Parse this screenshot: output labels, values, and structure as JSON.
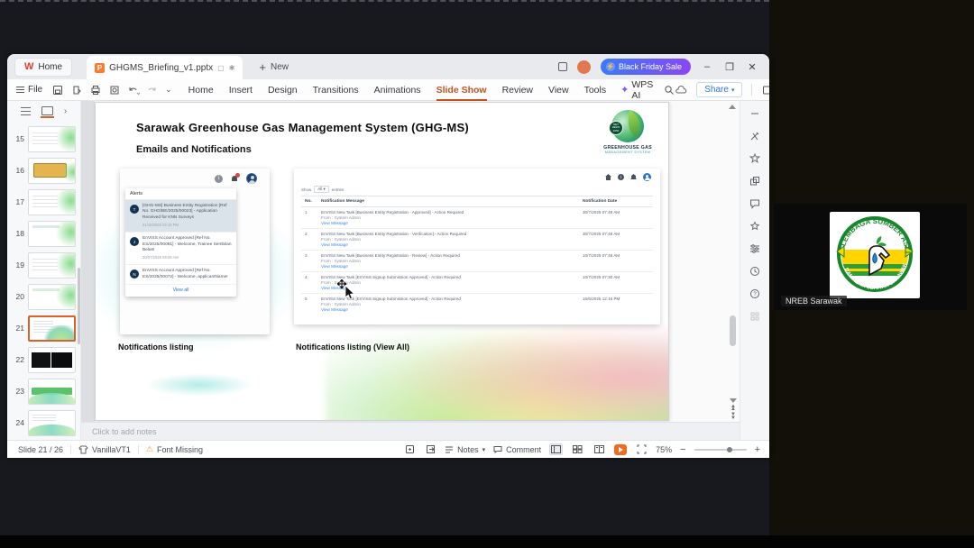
{
  "meeting": {
    "participant_label": "NREB Sarawak"
  },
  "titlebar": {
    "home_tab": "Home",
    "doc_tab": "GHGMS_Briefing_v1.pptx",
    "new_tab": "New",
    "promo": "Black Friday Sale",
    "minimize": "–",
    "maximize": "❐",
    "close": "✕"
  },
  "menubar": {
    "file": "File",
    "items": [
      "Home",
      "Insert",
      "Design",
      "Transitions",
      "Animations",
      "Slide Show",
      "Review",
      "View",
      "Tools"
    ],
    "active_item": "Slide Show",
    "wps_ai": "WPS AI",
    "share": "Share"
  },
  "thumbnails": {
    "current": "21",
    "add_label": "+",
    "slides": [
      {
        "num": "15",
        "variant": "rows"
      },
      {
        "num": "16",
        "variant": "yellow"
      },
      {
        "num": "17",
        "variant": "rows"
      },
      {
        "num": "18",
        "variant": "leaf"
      },
      {
        "num": "19",
        "variant": "rows"
      },
      {
        "num": "20",
        "variant": "leaf"
      },
      {
        "num": "21",
        "variant": "current"
      },
      {
        "num": "22",
        "variant": "dark"
      },
      {
        "num": "23",
        "variant": "banner"
      },
      {
        "num": "24",
        "variant": "wave"
      }
    ]
  },
  "slide": {
    "title": "Sarawak Greenhouse Gas Management System (GHG-MS)",
    "subtitle": "Emails and Notifications",
    "logo": {
      "badge": "NET ZERO 2050",
      "line1": "GREENHOUSE GAS",
      "line2": "MANAGEMENT SYSTEM"
    },
    "caption_left": "Notifications listing",
    "caption_right": "Notifications listing (View All)",
    "alerts": {
      "header": "Alerts",
      "view_all": "View all",
      "items": [
        {
          "initial": "T",
          "text": "[GHG-MS] Business Entity Registration [Ref No. GHG/BE/2025/00023] - Application Received for KNN Surveys",
          "time": "21/10/2025 02:19 PM",
          "selected": true
        },
        {
          "initial": "J",
          "text": "EnVISS Account Approved [Ref No. ES/2025/00081] - Welcome, Trainee Sembilan Belas!",
          "time": "30/07/2025 09:09 AM",
          "selected": false
        },
        {
          "initial": "N",
          "text": "EnVISS Account Approved [Ref No. ES/2025/00072] - Welcome, applicantName!",
          "time": "",
          "selected": false
        }
      ]
    },
    "table": {
      "show_label": "Show",
      "show_value": "All",
      "entries_label": "entries",
      "headers": [
        "No.",
        "Notification Message",
        "Notification Date"
      ],
      "rows": [
        {
          "no": "1",
          "message": "EnVISS New Task [Business Entity Registration - Approved] - Action Required",
          "from": "From : System Admin",
          "link": "View Message",
          "date": "30/7/2025 07:49 AM"
        },
        {
          "no": "2",
          "message": "EnVISS New Task [Business Entity Registration - Verification] - Action Required",
          "from": "From : System Admin",
          "link": "View Message",
          "date": "30/7/2025 07:48 AM"
        },
        {
          "no": "3",
          "message": "EnVISS New Task [Business Entity Registration - Review] - Action Required",
          "from": "From : System Admin",
          "link": "View Message",
          "date": "10/7/2025 07:46 AM"
        },
        {
          "no": "4",
          "message": "EnVISS New Task [EnVISS Signup Submission Approved] - Action Required",
          "from": "From : System Admin",
          "link": "View Message",
          "date": "10/7/2025 07:30 AM"
        },
        {
          "no": "5",
          "message": "EnVISS New Task [EnVISS Signup Submission Approved] - Action Required",
          "from": "From : System Admin",
          "link": "View Message",
          "date": "16/6/2025 12:16 PM"
        }
      ]
    }
  },
  "notes": {
    "placeholder": "Click to add notes"
  },
  "statusbar": {
    "slide_indicator": "Slide 21 / 26",
    "theme_name": "VanillaVT1",
    "font_missing": "Font Missing",
    "notes_label": "Notes",
    "comment_label": "Comment",
    "zoom_level": "75%"
  },
  "colors": {
    "accent_orange": "#c4541f",
    "share_blue": "#3473d9",
    "link_blue": "#3b82f6",
    "promo_gradient_from": "#3a7bf7",
    "promo_gradient_to": "#8a46f5"
  }
}
